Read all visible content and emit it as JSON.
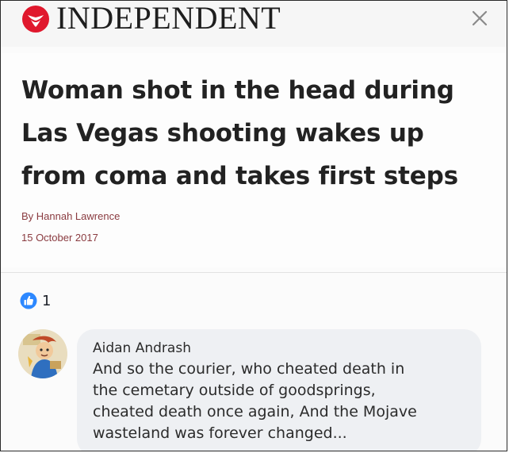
{
  "header": {
    "brand_name": "INDEPENDENT",
    "brand_logo_icon": "eagle-logo-icon",
    "brand_color": "#e0182d",
    "close_icon": "close-icon"
  },
  "article": {
    "headline_lines": [
      "Woman shot in the head during",
      "Las Vegas shooting wakes up",
      "from coma and takes first steps"
    ],
    "byline": "By Hannah Lawrence",
    "date": "15 October 2017"
  },
  "reactions": {
    "like_icon": "thumbs-up-icon",
    "like_color": "#2d88ff",
    "count": "1"
  },
  "comment": {
    "avatar_icon": "avatar-cartoon-icon",
    "author": "Aidan Andrash",
    "text_lines": [
      "And so the courier, who cheated death in",
      "the cemetary outside of goodsprings,",
      "cheated death once again, And the Mojave",
      "wasteland was forever changed..."
    ]
  }
}
